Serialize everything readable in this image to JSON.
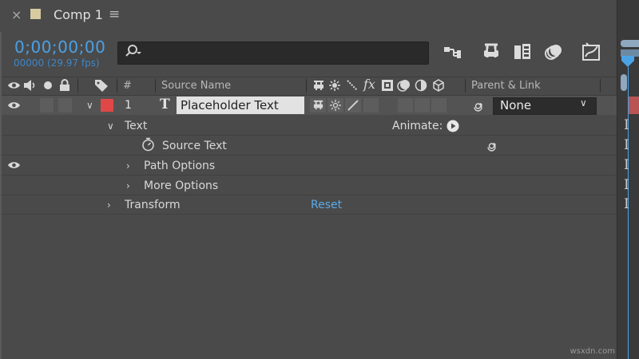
{
  "title_bar": {
    "close_glyph": "×",
    "comp_name": "Comp 1",
    "menu_glyph": "≡",
    "swatch_color": "#d8cba0"
  },
  "time": {
    "timecode": "0;00;00;00",
    "frames_fps": "00000 (29.97 fps)"
  },
  "search": {
    "value": "",
    "placeholder": ""
  },
  "toolbar_icons": [
    "composition-mini-flowchart-icon",
    "draft-3d-icon",
    "frame-blending-icon",
    "motion-blur-icon",
    "graph-editor-icon"
  ],
  "columns": {
    "number": "#",
    "source_name": "Source Name",
    "parent_link": "Parent & Link"
  },
  "layer": {
    "number": "1",
    "type_glyph": "T",
    "name": "Placeholder Text",
    "label_color": "#e04848",
    "parent": "None"
  },
  "properties": {
    "text": "Text",
    "animate": "Animate:",
    "source_text": "Source Text",
    "path_options": "Path Options",
    "more_options": "More Options",
    "transform": "Transform",
    "reset": "Reset"
  },
  "accent_color": "#4aa1e6",
  "watermark": "wsxdn.com"
}
